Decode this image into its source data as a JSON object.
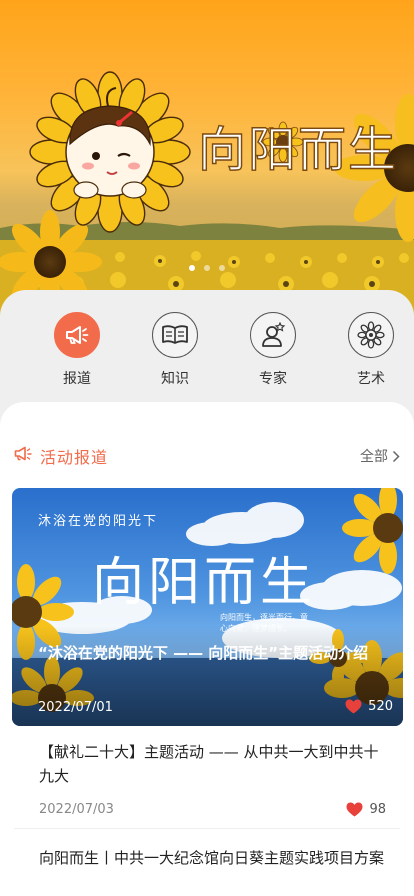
{
  "hero": {
    "title": "向阳而生",
    "slide_count": 3,
    "active_slide": 1
  },
  "categories": [
    {
      "label": "报道",
      "icon": "megaphone-icon",
      "active": true
    },
    {
      "label": "知识",
      "icon": "book-icon",
      "active": false
    },
    {
      "label": "专家",
      "icon": "expert-icon",
      "active": false
    },
    {
      "label": "艺术",
      "icon": "sunflower-icon",
      "active": false
    }
  ],
  "section": {
    "title": "活动报道",
    "more": "全部"
  },
  "feature": {
    "banner_subtitle": "沐浴在党的阳光下",
    "banner_title": "向阳而生",
    "banner_tagline": "向阳而生，逐光而行。童心向党，逐梦成长。",
    "caption": "“沐浴在党的阳光下 —— 向阳而生”主题活动介绍",
    "date": "2022/07/01",
    "likes": "520"
  },
  "articles": [
    {
      "title": "【献礼二十大】主题活动 —— 从中共一大到中共十九大",
      "date": "2022/07/03",
      "likes": "98"
    },
    {
      "title": "向阳而生丨中共一大纪念馆向日葵主题实践项目方案"
    }
  ],
  "colors": {
    "accent": "#f26b4b",
    "like": "#e8403a",
    "hero_orange": "#ffa41a"
  }
}
